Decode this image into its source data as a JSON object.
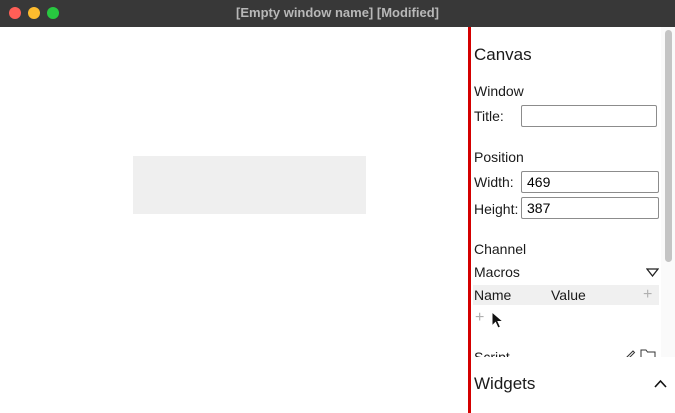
{
  "window": {
    "title": "[Empty window name] [Modified]"
  },
  "panel": {
    "heading": "Canvas",
    "window_section": {
      "label": "Window",
      "title_label": "Title:",
      "title_value": ""
    },
    "position_section": {
      "label": "Position",
      "width_label": "Width:",
      "width_value": "469",
      "height_label": "Height:",
      "height_value": "387"
    },
    "channel_section": {
      "label": "Channel"
    },
    "macros": {
      "label": "Macros",
      "col_name": "Name",
      "col_value": "Value",
      "add_symbol": "+"
    },
    "script_section": {
      "label": "Script"
    },
    "widgets": {
      "label": "Widgets"
    }
  },
  "icons": [
    "chevron-down-icon",
    "plus-icon",
    "pencil-icon",
    "folder-icon",
    "chevron-up-icon",
    "mouse-cursor-icon"
  ],
  "colors": {
    "titlebar": "#383838",
    "divider": "#d40000",
    "canvas_rect": "#efefef"
  }
}
